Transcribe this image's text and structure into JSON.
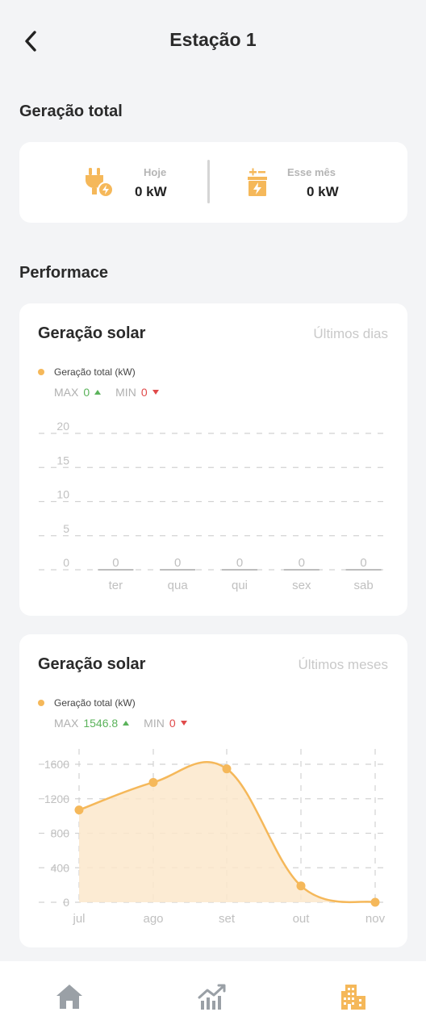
{
  "header": {
    "title": "Estação 1"
  },
  "total": {
    "title": "Geração total",
    "today_label": "Hoje",
    "today_value": "0 kW",
    "month_label": "Esse mês",
    "month_value": "0 kW"
  },
  "performance": {
    "title": "Performace"
  },
  "daily": {
    "title": "Geração solar",
    "range": "Últimos dias",
    "legend": "Geração total (kW)",
    "max_label": "MAX",
    "max_value": "0",
    "min_label": "MIN",
    "min_value": "0"
  },
  "monthly": {
    "title": "Geração solar",
    "range": "Últimos meses",
    "legend": "Geração total (kW)",
    "max_label": "MAX",
    "max_value": "1546.8",
    "min_label": "MIN",
    "min_value": "0"
  },
  "colors": {
    "accent": "#f5b85a",
    "max": "#5bb35b",
    "min": "#e04a4a",
    "nav_active": "#f5b85a",
    "nav_inactive": "#9aa0a6"
  },
  "icons": {
    "back": "chevron-left-icon",
    "today": "plug-icon",
    "month": "battery-charge-icon",
    "nav": [
      "home-icon",
      "chart-icon",
      "building-icon"
    ]
  },
  "chart_data": [
    {
      "type": "bar",
      "title": "Geração solar",
      "categories": [
        "ter",
        "qua",
        "qui",
        "sex",
        "sab"
      ],
      "series": [
        {
          "name": "Geração total (kW)",
          "values": [
            0,
            0,
            0,
            0,
            0
          ]
        }
      ],
      "yticks": [
        0,
        5,
        10,
        15,
        20
      ],
      "ylim": [
        0,
        20
      ],
      "grid": true,
      "legend": "top-left"
    },
    {
      "type": "area",
      "title": "Geração solar",
      "categories": [
        "jul",
        "ago",
        "set",
        "out",
        "nov"
      ],
      "series": [
        {
          "name": "Geração total (kW)",
          "values": [
            1070,
            1390,
            1546.8,
            190,
            0
          ]
        }
      ],
      "yticks": [
        0,
        400,
        800,
        1200,
        1600
      ],
      "ylim": [
        0,
        1600
      ],
      "grid": true,
      "legend": "top-left"
    }
  ]
}
